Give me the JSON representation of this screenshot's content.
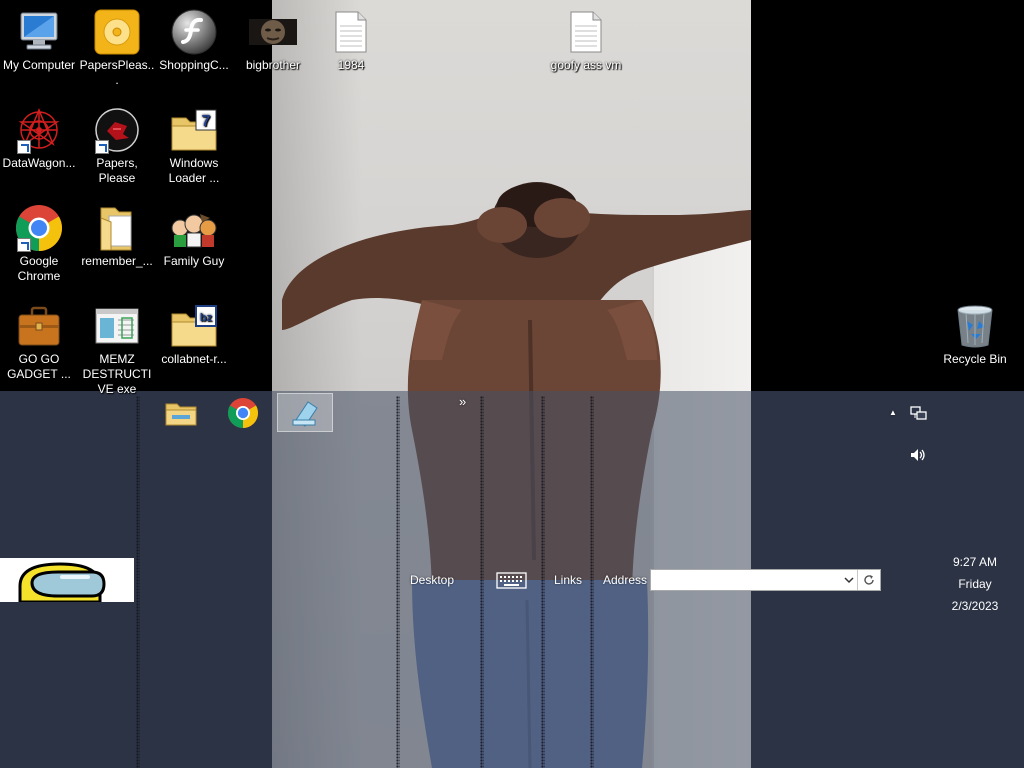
{
  "desktop": {
    "icons": [
      {
        "label": "My Computer",
        "icon": "computer-icon"
      },
      {
        "label": "PapersPleas...",
        "icon": "disc-icon"
      },
      {
        "label": "ShoppingC...",
        "icon": "flash-icon"
      },
      {
        "label": "bigbrother",
        "icon": "image-thumbnail-icon"
      },
      {
        "label": "1984",
        "icon": "text-document-icon"
      },
      {
        "label": "goofy ass vm",
        "icon": "text-document-icon"
      },
      {
        "label": "DataWagon...",
        "icon": "red-pattern-icon"
      },
      {
        "label": "Papers, Please",
        "icon": "papers-please-icon"
      },
      {
        "label": "Windows Loader ...",
        "icon": "folder-icon"
      },
      {
        "label": "Google Chrome",
        "icon": "chrome-icon"
      },
      {
        "label": "remember_...",
        "icon": "folder-icon"
      },
      {
        "label": "Family Guy",
        "icon": "family-guy-icon"
      },
      {
        "label": "GO GO GADGET ...",
        "icon": "briefcase-icon"
      },
      {
        "label": "MEMZ DESTRUCTIVE exe",
        "icon": "window-app-icon"
      },
      {
        "label": "collabnet-r...",
        "icon": "folder-icon"
      },
      {
        "label": "Recycle Bin",
        "icon": "recycle-bin-icon"
      }
    ]
  },
  "taskbar": {
    "pinned": [
      {
        "name": "file-explorer",
        "icon": "folder-icon"
      },
      {
        "name": "google-chrome",
        "icon": "chrome-icon"
      },
      {
        "name": "notepad",
        "icon": "notepad-icon",
        "active": true
      }
    ],
    "chevron": "»",
    "desktop_label": "Desktop",
    "links_label": "Links",
    "address_label": "Address",
    "address_value": "",
    "tray_up": "▲"
  },
  "clock": {
    "time": "9:27 AM",
    "day": "Friday",
    "date": "2/3/2023"
  },
  "colors": {
    "taskbar": "#465064",
    "taskbar_side": "#2c3446",
    "among_us_yellow": "#f5e22a"
  }
}
